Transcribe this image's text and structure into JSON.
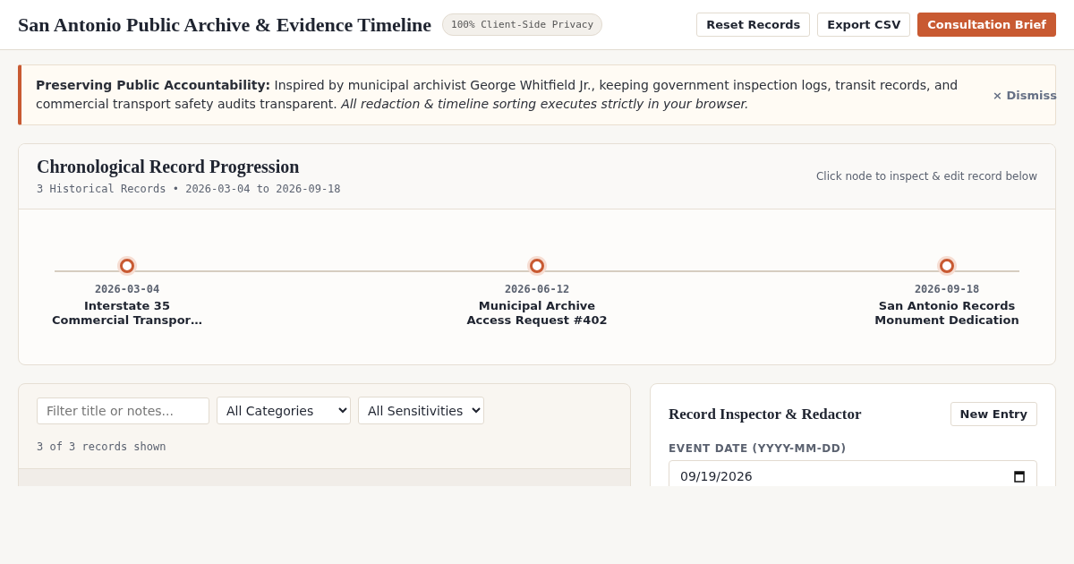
{
  "header": {
    "title": "San Antonio Public Archive & Evidence Timeline",
    "badge": "100% Client-Side Privacy",
    "buttons": [
      {
        "label": "Reset Records",
        "kind": "secondary"
      },
      {
        "label": "Export CSV",
        "kind": "secondary"
      },
      {
        "label": "Consultation Brief",
        "kind": "primary"
      }
    ]
  },
  "notice": {
    "text": "**Preserving Public Accountability:** Inspired by municipal archivist George Whitfield Jr., keeping government inspection logs, transit records, and commercial transport safety audits transparent. *All redaction & timeline sorting executes strictly in your browser.*",
    "dismiss": "× Dismiss"
  },
  "timeline": {
    "title": "Chronological Record Progression",
    "summary": "3 Historical Records • 2026-03-04 to 2026-09-18",
    "hint": "Click node to inspect & edit record below",
    "events": [
      {
        "date": "2026-03-04",
        "title": "Interstate 35 Commercial Transpor…"
      },
      {
        "date": "2026-06-12",
        "title": "Municipal Archive Access Request #402"
      },
      {
        "date": "2026-09-18",
        "title": "San Antonio Records Monument Dedication"
      }
    ]
  },
  "records": {
    "filter": {
      "placeholder": "Filter title or notes..."
    },
    "selects": [
      "All Categories",
      "All Sensitivities"
    ],
    "count": "3 of 3 records shown"
  },
  "inspector": {
    "title": "Record Inspector & Redactor",
    "button": "New Entry",
    "fields": [
      {
        "label": "EVENT DATE (YYYY-MM-DD)",
        "value": "09/19/2026"
      }
    ]
  }
}
